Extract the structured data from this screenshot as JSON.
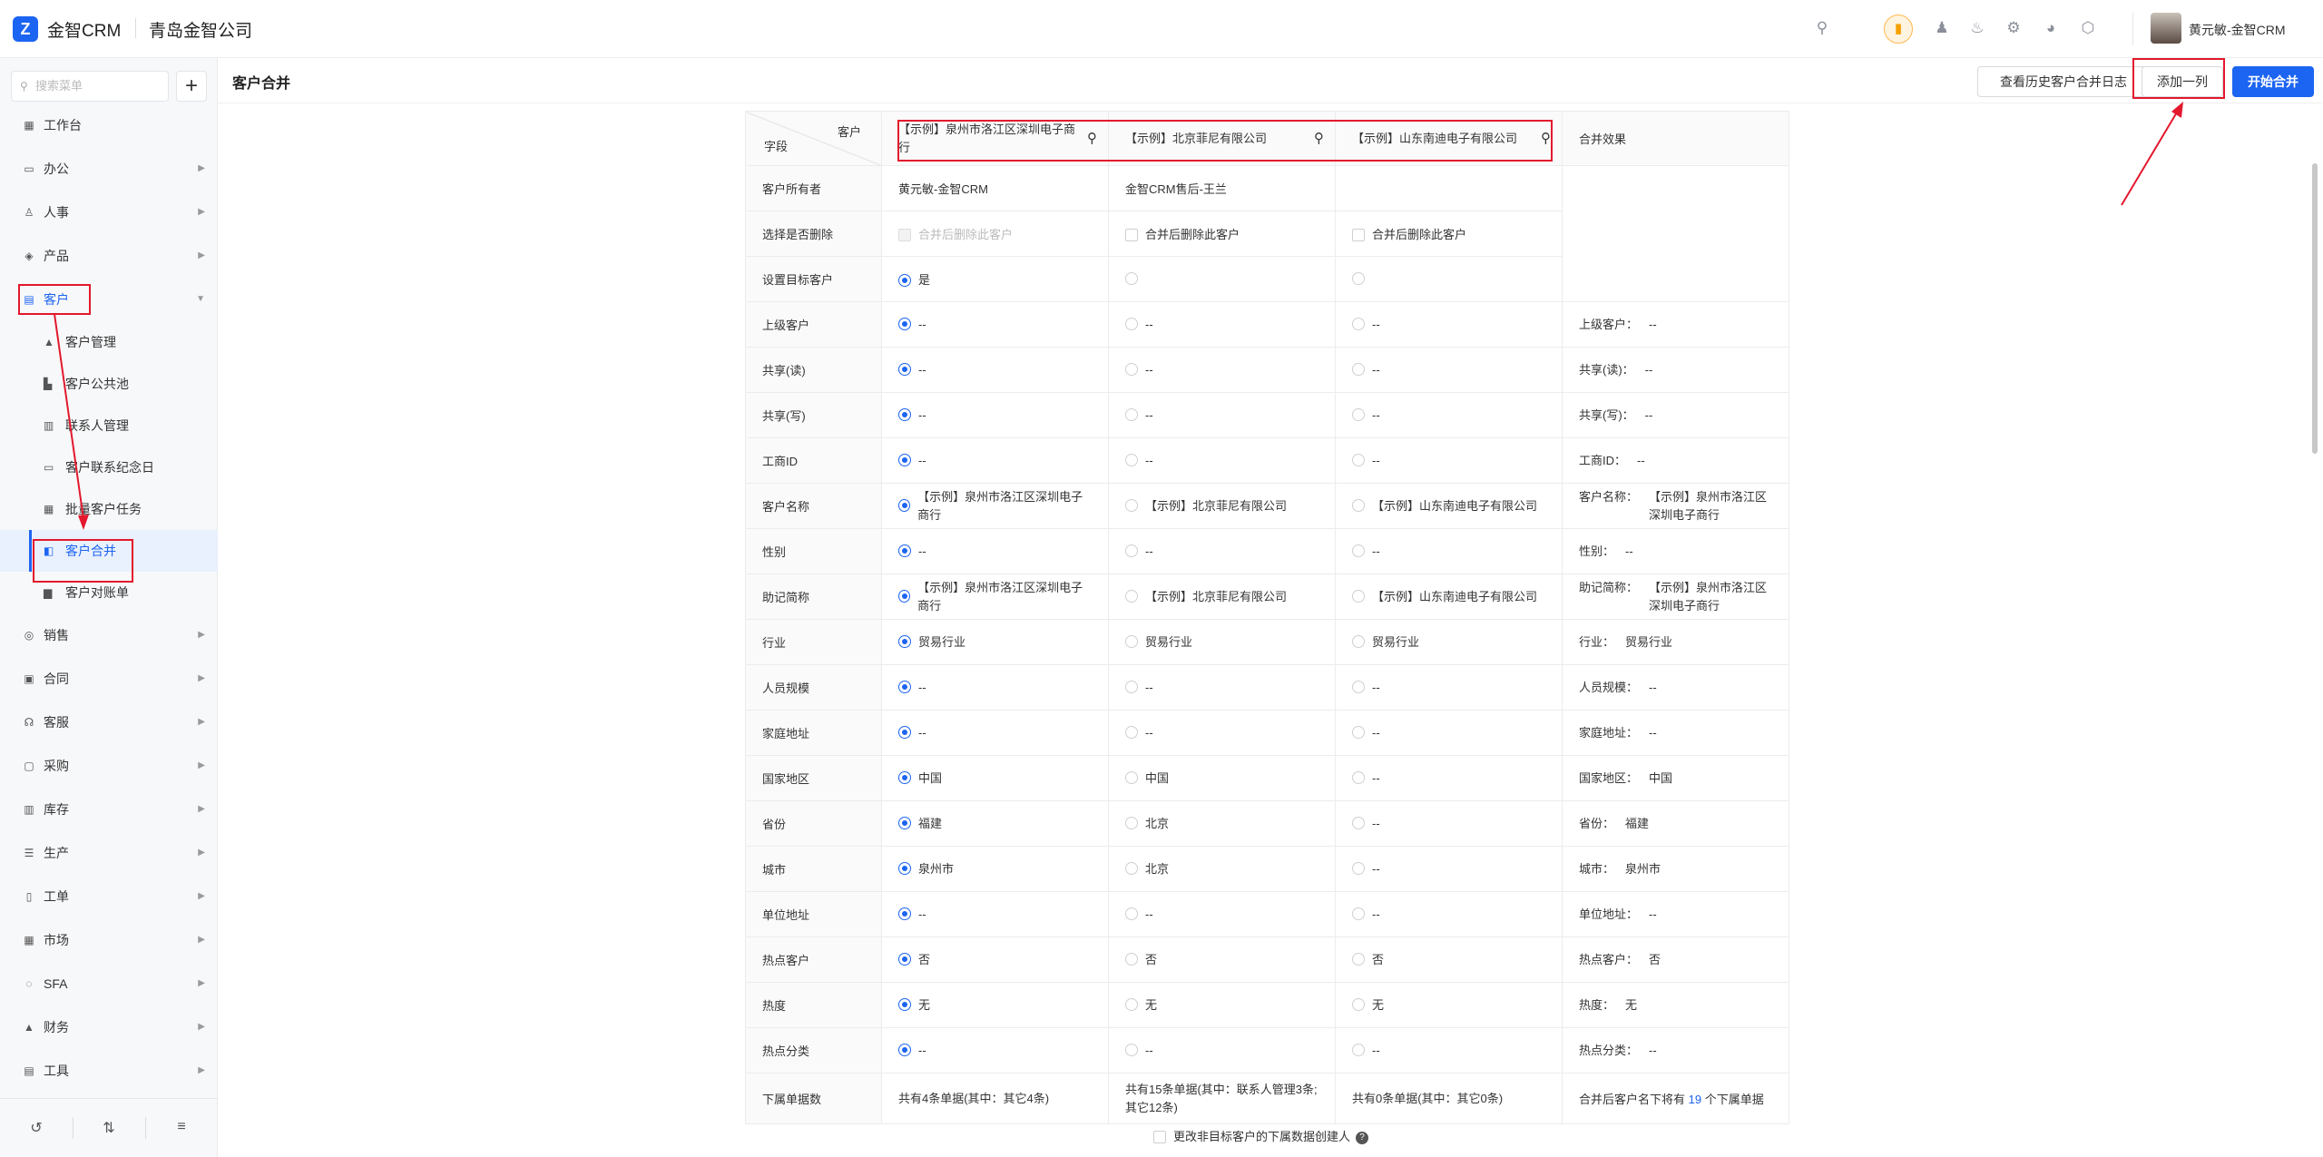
{
  "app": {
    "logo_mark": "Z",
    "name": "金智CRM",
    "company": "青岛金智公司",
    "user": "黄元敏-金智CRM"
  },
  "topbar_icons": [
    "search-icon",
    "megaphone-icon",
    "contacts-icon",
    "bell-icon",
    "settings-icon",
    "pie-chart-icon",
    "cube-icon"
  ],
  "sidebar": {
    "search_placeholder": "搜索菜单",
    "add_label": "+",
    "items": [
      {
        "label": "工作台",
        "icon": "▦"
      },
      {
        "label": "办公",
        "icon": "▭"
      },
      {
        "label": "人事",
        "icon": "♙"
      },
      {
        "label": "产品",
        "icon": "◈"
      },
      {
        "label": "客户",
        "icon": "▤"
      },
      {
        "label": "销售",
        "icon": "◎"
      },
      {
        "label": "合同",
        "icon": "▣"
      },
      {
        "label": "客服",
        "icon": "☊"
      },
      {
        "label": "采购",
        "icon": "▢"
      },
      {
        "label": "库存",
        "icon": "▥"
      },
      {
        "label": "生产",
        "icon": "☰"
      },
      {
        "label": "工单",
        "icon": "▯"
      },
      {
        "label": "市场",
        "icon": "▦"
      },
      {
        "label": "SFA",
        "icon": "◌"
      },
      {
        "label": "财务",
        "icon": "▲"
      },
      {
        "label": "工具",
        "icon": "▤"
      }
    ],
    "sub_items": [
      {
        "label": "客户管理",
        "icon": "▲"
      },
      {
        "label": "客户公共池",
        "icon": "▙"
      },
      {
        "label": "联系人管理",
        "icon": "▥"
      },
      {
        "label": "客户联系纪念日",
        "icon": "▭"
      },
      {
        "label": "批量客户任务",
        "icon": "▦"
      },
      {
        "label": "客户合并",
        "icon": "◧"
      },
      {
        "label": "客户对账单",
        "icon": "▆"
      }
    ],
    "bottom_icons": [
      "history-icon",
      "sliders-icon",
      "menu-collapse-icon"
    ]
  },
  "page": {
    "title": "客户合并",
    "btn_history": "查看历史客户合并日志",
    "btn_add_col": "添加一列",
    "btn_start": "开始合并"
  },
  "table": {
    "hdr_customer": "客户",
    "hdr_field": "字段",
    "hdr_effect": "合并效果",
    "customers": [
      "【示例】泉州市洛江区深圳电子商行",
      "【示例】北京菲尼有限公司",
      "【示例】山东南迪电子有限公司"
    ],
    "owner_label": "客户所有者",
    "owners": [
      "黄元敏-金智CRM",
      "金智CRM售后-王兰",
      ""
    ],
    "delete_label": "选择是否删除",
    "delete_text": "合并后删除此客户",
    "target_label": "设置目标客户",
    "target_yes": "是",
    "rows": [
      {
        "field": "上级客户",
        "vals": [
          "--",
          "--",
          "--"
        ],
        "effect_k": "上级客户：",
        "effect_v": "--"
      },
      {
        "field": "共享(读)",
        "vals": [
          "--",
          "--",
          "--"
        ],
        "effect_k": "共享(读)：",
        "effect_v": "--"
      },
      {
        "field": "共享(写)",
        "vals": [
          "--",
          "--",
          "--"
        ],
        "effect_k": "共享(写)：",
        "effect_v": "--"
      },
      {
        "field": "工商ID",
        "vals": [
          "--",
          "--",
          "--"
        ],
        "effect_k": "工商ID：",
        "effect_v": "--"
      },
      {
        "field": "客户名称",
        "vals": [
          "【示例】泉州市洛江区深圳电子商行",
          "【示例】北京菲尼有限公司",
          "【示例】山东南迪电子有限公司"
        ],
        "effect_k": "客户名称：",
        "effect_v": "【示例】泉州市洛江区深圳电子商行"
      },
      {
        "field": "性别",
        "vals": [
          "--",
          "--",
          "--"
        ],
        "effect_k": "性别：",
        "effect_v": "--"
      },
      {
        "field": "助记简称",
        "vals": [
          "【示例】泉州市洛江区深圳电子商行",
          "【示例】北京菲尼有限公司",
          "【示例】山东南迪电子有限公司"
        ],
        "effect_k": "助记简称：",
        "effect_v": "【示例】泉州市洛江区深圳电子商行"
      },
      {
        "field": "行业",
        "vals": [
          "贸易行业",
          "贸易行业",
          "贸易行业"
        ],
        "effect_k": "行业：",
        "effect_v": "贸易行业"
      },
      {
        "field": "人员规模",
        "vals": [
          "--",
          "--",
          "--"
        ],
        "effect_k": "人员规模：",
        "effect_v": "--"
      },
      {
        "field": "家庭地址",
        "vals": [
          "--",
          "--",
          "--"
        ],
        "effect_k": "家庭地址：",
        "effect_v": "--"
      },
      {
        "field": "国家地区",
        "vals": [
          "中国",
          "中国",
          "--"
        ],
        "effect_k": "国家地区：",
        "effect_v": "中国"
      },
      {
        "field": "省份",
        "vals": [
          "福建",
          "北京",
          "--"
        ],
        "effect_k": "省份：",
        "effect_v": "福建"
      },
      {
        "field": "城市",
        "vals": [
          "泉州市",
          "北京",
          "--"
        ],
        "effect_k": "城市：",
        "effect_v": "泉州市"
      },
      {
        "field": "单位地址",
        "vals": [
          "--",
          "--",
          "--"
        ],
        "effect_k": "单位地址：",
        "effect_v": "--"
      },
      {
        "field": "热点客户",
        "vals": [
          "否",
          "否",
          "否"
        ],
        "effect_k": "热点客户：",
        "effect_v": "否"
      },
      {
        "field": "热度",
        "vals": [
          "无",
          "无",
          "无"
        ],
        "effect_k": "热度：",
        "effect_v": "无"
      },
      {
        "field": "热点分类",
        "vals": [
          "--",
          "--",
          "--"
        ],
        "effect_k": "热点分类：",
        "effect_v": "--"
      }
    ],
    "sub_label": "下属单据数",
    "sub_vals": [
      "共有4条单据(其中：其它4条)",
      "共有15条单据(其中：联系人管理3条;其它12条)",
      "共有0条单据(其中：其它0条)"
    ],
    "sub_effect_pre": "合并后客户名下将有",
    "sub_effect_num": "19",
    "sub_effect_post": "个下属单据"
  },
  "footer_option": "更改非目标客户的下属数据创建人",
  "footer_help": "?"
}
